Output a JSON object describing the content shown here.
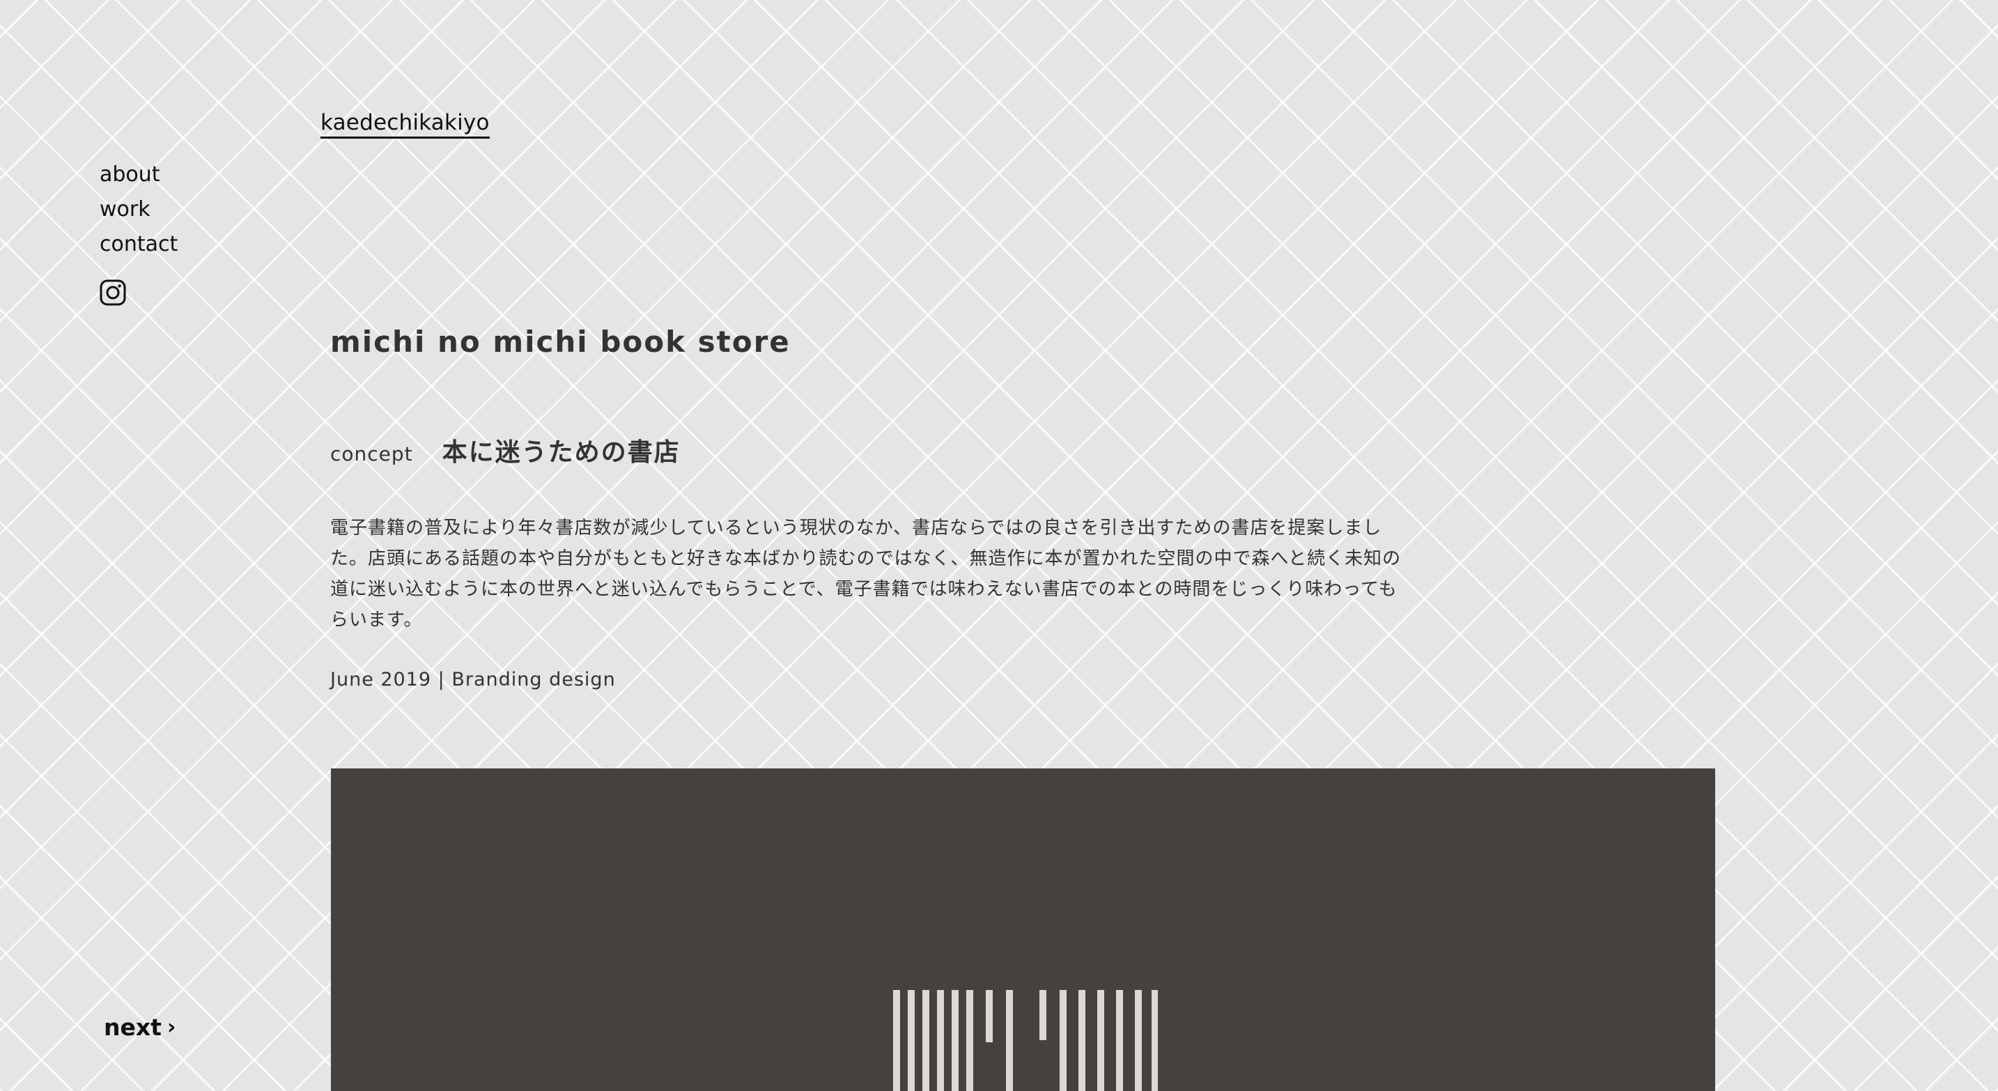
{
  "site": {
    "logo": "kaedechikakiyo"
  },
  "nav": {
    "items": [
      {
        "label": "about"
      },
      {
        "label": "work"
      },
      {
        "label": "contact"
      }
    ],
    "social_icon": "instagram-icon"
  },
  "project": {
    "title": "michi no michi book store",
    "concept_label": "concept",
    "concept_title": "本に迷うための書店",
    "description": "電子書籍の普及により年々書店数が減少しているという現状のなか、書店ならではの良さを引き出すための書店を提案しました。店頭にある話題の本や自分がもともと好きな本ばかり読むのではなく、無造作に本が置かれた空間の中で森へと続く未知の道に迷い込むように本の世界へと迷い込んでもらうことで、電子書籍では味わえない書店での本との時間をじっくり味わってもらいます。",
    "meta": "June 2019 | Branding design"
  },
  "pagination": {
    "next_label": "next",
    "next_icon": "chevron-right-icon"
  },
  "colors": {
    "background": "#e5e5e7",
    "pattern_line": "#ffffff",
    "text": "#333333",
    "hero_background": "#45413e",
    "hero_mark": "#dcd8d3"
  }
}
